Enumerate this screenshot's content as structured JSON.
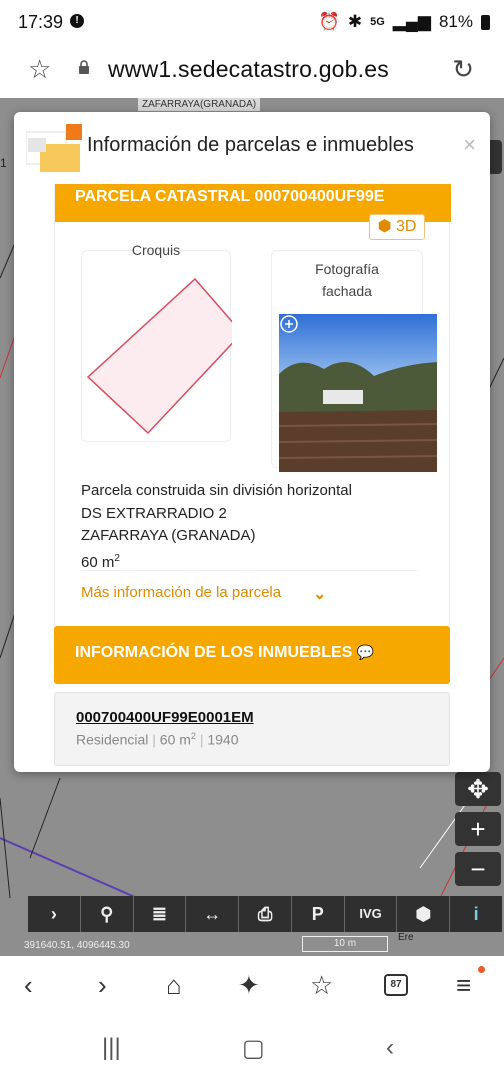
{
  "status_bar": {
    "time": "17:39",
    "battery": "81%",
    "network": "5G"
  },
  "browser": {
    "url": "www1.sedecatastro.gob.es",
    "tabs_count": "87"
  },
  "map": {
    "top_label": "ZAFARRAYA(GRANADA)",
    "coordinates": "391640.51, 4096445.30",
    "scale": "10 m",
    "scale_end": "Ere",
    "side_number": "1",
    "toolbar": [
      "›",
      "⚲",
      "≣",
      "↔",
      "⎙",
      "P",
      "IVG",
      "⬢",
      "i"
    ]
  },
  "dialog": {
    "title": "Información de parcelas e inmuebles",
    "close": "×"
  },
  "parcela": {
    "header": "PARCELA CATASTRAL 000700400UF99E",
    "btn_3d": "3D",
    "croquis_label": "Croquis",
    "foto_label_line1": "Fotografía",
    "foto_label_line2": "fachada",
    "tipo": "Parcela construida sin división horizontal",
    "direccion": "DS EXTRARRADIO 2",
    "municipio": "ZAFARRAYA (GRANADA)",
    "superficie": "60 m",
    "superficie_exp": "2",
    "mas_info": "Más información de la parcela"
  },
  "inmuebles": {
    "header": "INFORMACIÓN DE LOS INMUEBLES",
    "items": [
      {
        "ref": "000700400UF99E0001EM",
        "uso": "Residencial",
        "superficie": "60 m",
        "superficie_exp": "2",
        "anio": "1940"
      }
    ]
  },
  "colors": {
    "accent_orange": "#f7a800",
    "link_orange": "#e08a00"
  }
}
